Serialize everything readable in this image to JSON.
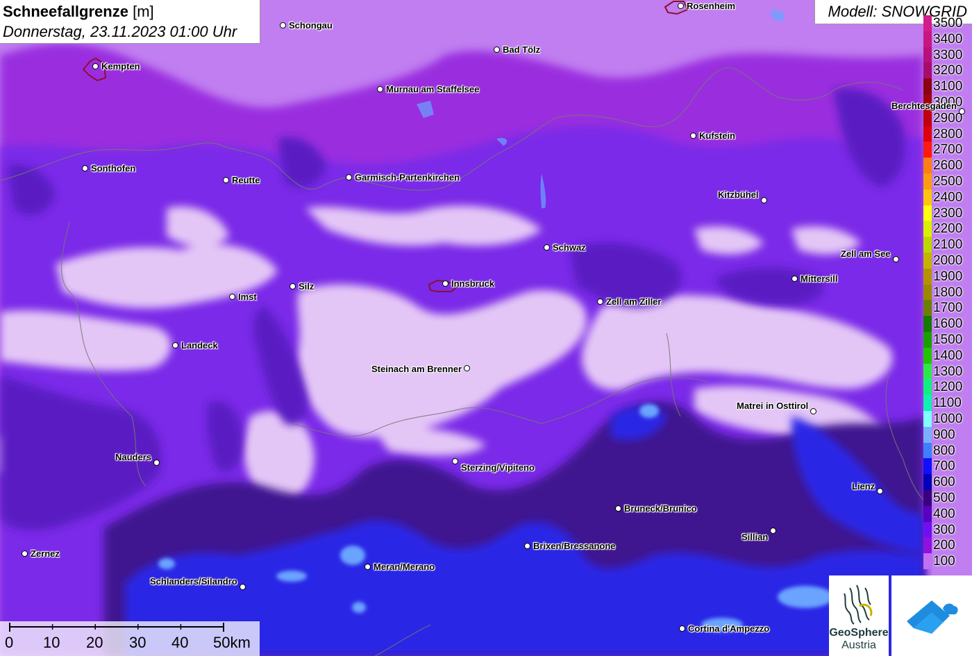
{
  "title": {
    "main": "Schneefallgrenze",
    "unit": "[m]",
    "datetime": "Donnerstag, 23.11.2023 01:00 Uhr"
  },
  "model": "Modell: SNOWGRID",
  "legend": [
    {
      "label": "3500",
      "color": "#d21d8c"
    },
    {
      "label": "3400",
      "color": "#c71684"
    },
    {
      "label": "3300",
      "color": "#b9107c"
    },
    {
      "label": "3200",
      "color": "#a60d6d"
    },
    {
      "label": "3100",
      "color": "#8b0010"
    },
    {
      "label": "3000",
      "color": "#a0000e"
    },
    {
      "label": "2900",
      "color": "#c00010"
    },
    {
      "label": "2800",
      "color": "#dd0010"
    },
    {
      "label": "2700",
      "color": "#ff1a10"
    },
    {
      "label": "2600",
      "color": "#ff7f10"
    },
    {
      "label": "2500",
      "color": "#ff9c10"
    },
    {
      "label": "2400",
      "color": "#ffc410"
    },
    {
      "label": "2300",
      "color": "#ffff10"
    },
    {
      "label": "2200",
      "color": "#d9f000"
    },
    {
      "label": "2100",
      "color": "#bfd600"
    },
    {
      "label": "2000",
      "color": "#c4b300"
    },
    {
      "label": "1900",
      "color": "#b59300"
    },
    {
      "label": "1800",
      "color": "#9a8a00"
    },
    {
      "label": "1700",
      "color": "#6b8000"
    },
    {
      "label": "1600",
      "color": "#157a00"
    },
    {
      "label": "1500",
      "color": "#1a9e00"
    },
    {
      "label": "1400",
      "color": "#22c400"
    },
    {
      "label": "1300",
      "color": "#2ee84a"
    },
    {
      "label": "1200",
      "color": "#10f080"
    },
    {
      "label": "1100",
      "color": "#10f0b0"
    },
    {
      "label": "1000",
      "color": "#80ffff"
    },
    {
      "label": "900",
      "color": "#7ab0ff"
    },
    {
      "label": "800",
      "color": "#3f80ff"
    },
    {
      "label": "700",
      "color": "#1010ff"
    },
    {
      "label": "600",
      "color": "#0000b8"
    },
    {
      "label": "500",
      "color": "#3a0080"
    },
    {
      "label": "400",
      "color": "#5800c0"
    },
    {
      "label": "300",
      "color": "#7010f0"
    },
    {
      "label": "200",
      "color": "#9010e0"
    },
    {
      "label": "100",
      "color": "#c070f0"
    }
  ],
  "cities": [
    {
      "name": "Rosenheim",
      "label_side": "right"
    },
    {
      "name": "Schongau",
      "label_side": "right"
    },
    {
      "name": "Kempten",
      "label_side": "right"
    },
    {
      "name": "Bad Tölz",
      "label_side": "right"
    },
    {
      "name": "Murnau am Staffelsee",
      "label_side": "right"
    },
    {
      "name": "Berchtesgaden",
      "label_side": "left"
    },
    {
      "name": "Kufstein",
      "label_side": "right"
    },
    {
      "name": "Sonthofen",
      "label_side": "right"
    },
    {
      "name": "Reutte",
      "label_side": "right"
    },
    {
      "name": "Garmisch-Partenkirchen",
      "label_side": "right"
    },
    {
      "name": "Kitzbühel",
      "label_side": "left"
    },
    {
      "name": "Schwaz",
      "label_side": "right"
    },
    {
      "name": "Zell am See",
      "label_side": "left"
    },
    {
      "name": "Mittersill",
      "label_side": "right"
    },
    {
      "name": "Innsbruck",
      "label_side": "right"
    },
    {
      "name": "Silz",
      "label_side": "right"
    },
    {
      "name": "Imst",
      "label_side": "right"
    },
    {
      "name": "Zell am Ziller",
      "label_side": "right"
    },
    {
      "name": "Landeck",
      "label_side": "right"
    },
    {
      "name": "Steinach am Brenner",
      "label_side": "left"
    },
    {
      "name": "Matrei in Osttirol",
      "label_side": "left"
    },
    {
      "name": "Nauders",
      "label_side": "left"
    },
    {
      "name": "Sterzing/Vipiteno",
      "label_side": "right"
    },
    {
      "name": "Lienz",
      "label_side": "left"
    },
    {
      "name": "Bruneck/Brunico",
      "label_side": "right"
    },
    {
      "name": "Sillian",
      "label_side": "left"
    },
    {
      "name": "Brixen/Bressanone",
      "label_side": "right"
    },
    {
      "name": "Zernez",
      "label_side": "right"
    },
    {
      "name": "Meran/Merano",
      "label_side": "right"
    },
    {
      "name": "Schlanders/Silandro",
      "label_side": "left"
    },
    {
      "name": "Cortina d'Ampezzo",
      "label_side": "right"
    }
  ],
  "scale": {
    "labels": [
      "0",
      "10",
      "20",
      "30",
      "40",
      "50km"
    ]
  },
  "logos": {
    "geosphere_line1": "GeoSphere",
    "geosphere_line2": "Austria"
  },
  "colors": {
    "zone_100": "#c27ef2",
    "zone_200": "#9a35e0",
    "zone_300": "#7a28e8",
    "zone_400": "#5c1ec0",
    "zone_500": "#3d1288",
    "zone_700": "#2424e8",
    "zone_900": "#6aa8ff",
    "below_100": "#e6c8f5"
  }
}
